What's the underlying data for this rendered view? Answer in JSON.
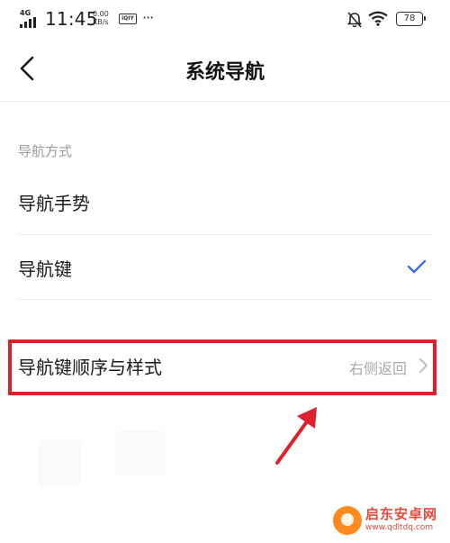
{
  "status_bar": {
    "network": "4G",
    "time": "11:45",
    "speed_value": "0.00",
    "speed_unit": "KB/s",
    "app_badge": "iQIY",
    "more": "···",
    "battery": "78"
  },
  "header": {
    "title": "系统导航"
  },
  "section": {
    "label": "导航方式",
    "options": [
      {
        "label": "导航手势",
        "selected": false
      },
      {
        "label": "导航键",
        "selected": true
      }
    ]
  },
  "settings": {
    "nav_keys_order": {
      "label": "导航键顺序与样式",
      "value": "右侧返回"
    }
  },
  "watermark": {
    "name": "启东安卓网",
    "url": "www.qdltdq.com"
  },
  "colors": {
    "accent": "#3d6fe8",
    "annotation": "#e0202b"
  }
}
